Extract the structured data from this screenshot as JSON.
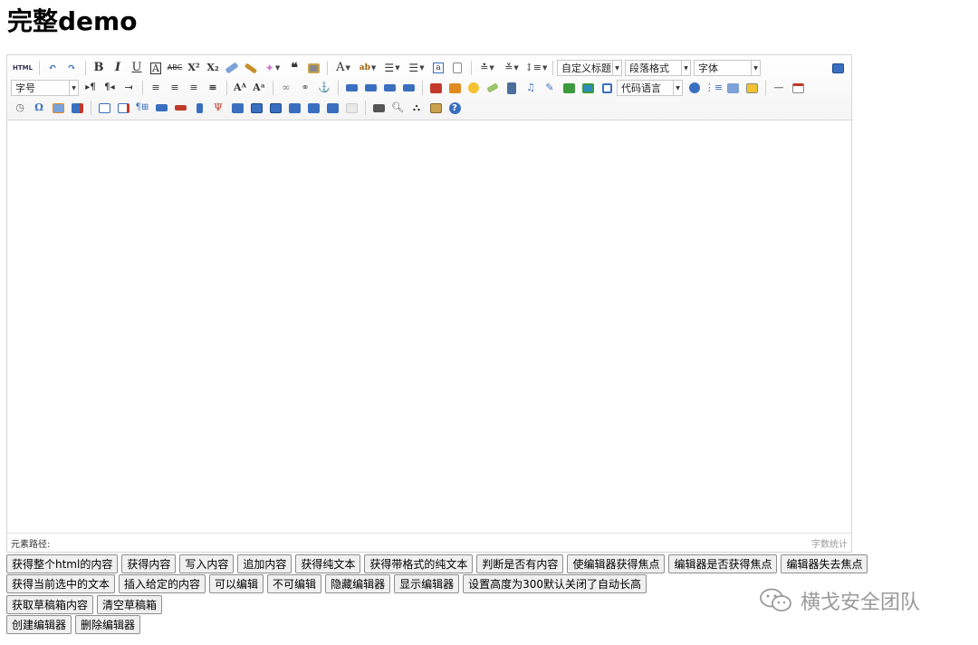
{
  "page": {
    "title": "完整demo"
  },
  "toolbar": {
    "row1": {
      "html_label": "HTML",
      "buttons": [
        "undo-icon",
        "redo-icon",
        "bold-icon",
        "italic-icon",
        "underline-icon",
        "fontborder-icon",
        "strikethrough-icon",
        "superscript-icon",
        "subscript-icon",
        "removeformat-icon",
        "formatmatch-icon",
        "autotypeset-icon",
        "blockquote-icon",
        "pasteplain-icon",
        "forecolor-icon",
        "backcolor-icon",
        "insertorderedlist-icon",
        "insertunorderedlist-icon",
        "selectall-icon",
        "cleardoc-icon",
        "rowspacingtop-icon",
        "rowspacingbottom-icon",
        "lineheight-icon",
        "fullscreen-icon"
      ],
      "custom_heading": "自定义标题",
      "paragraph": "段落格式",
      "font_family": "字体"
    },
    "row2": {
      "font_size": "字号",
      "code_language": "代码语言",
      "buttons": [
        "directionalityltr-icon",
        "directionalityrtl-icon",
        "indent-icon",
        "justifyleft-icon",
        "justifycenter-icon",
        "justifyright-icon",
        "justifyjustify-icon",
        "touppercase-icon",
        "tolowercase-icon",
        "link-icon",
        "unlink-icon",
        "anchor-icon",
        "imagenone-icon",
        "imageleft-icon",
        "imageright-icon",
        "imagecenter-icon",
        "simpleupload-icon",
        "insertimage-icon",
        "emotion-icon",
        "scrawl-icon",
        "insertvideo-icon",
        "music-icon",
        "attachment-icon",
        "map-icon",
        "gmap-icon",
        "insertframe-icon",
        "insertcode-icon",
        "webapp-icon",
        "pagebreak-icon",
        "template-icon",
        "background-icon",
        "horizontal-icon",
        "date-icon"
      ]
    },
    "row3": {
      "buttons": [
        "time-icon",
        "spechars-icon",
        "snapscreen-icon",
        "wordimage-icon",
        "inserttable-icon",
        "deletetable-icon",
        "insertparagraphbeforetable-icon",
        "insertrow-icon",
        "deleterow-icon",
        "insertcol-icon",
        "deletecol-icon",
        "mergecells-icon",
        "mergeright-icon",
        "mergedown-icon",
        "splittocells-icon",
        "splittorows-icon",
        "splittocols-icon",
        "charts-icon",
        "print-icon",
        "preview-icon",
        "searchreplace-icon",
        "drafts-icon",
        "help-icon"
      ]
    }
  },
  "statusbar": {
    "element_path": "元素路径:",
    "word_count": "字数统计"
  },
  "buttons": {
    "row1": [
      "获得整个html的内容",
      "获得内容",
      "写入内容",
      "追加内容",
      "获得纯文本",
      "获得带格式的纯文本",
      "判断是否有内容",
      "使编辑器获得焦点",
      "编辑器是否获得焦点",
      "编辑器失去焦点"
    ],
    "row2": [
      "获得当前选中的文本",
      "插入给定的内容",
      "可以编辑",
      "不可编辑",
      "隐藏编辑器",
      "显示编辑器",
      "设置高度为300默认关闭了自动长高"
    ],
    "row3": [
      "获取草稿箱内容",
      "清空草稿箱"
    ],
    "row4": [
      "创建编辑器",
      "删除编辑器"
    ]
  },
  "watermark": {
    "text": "横戈安全团队",
    "icon": "wechat-icon"
  },
  "colors": {
    "icon_blue": "#3a6fc0",
    "icon_orange": "#e08a1e",
    "icon_red": "#c0392b",
    "icon_green": "#3c9a3c"
  }
}
